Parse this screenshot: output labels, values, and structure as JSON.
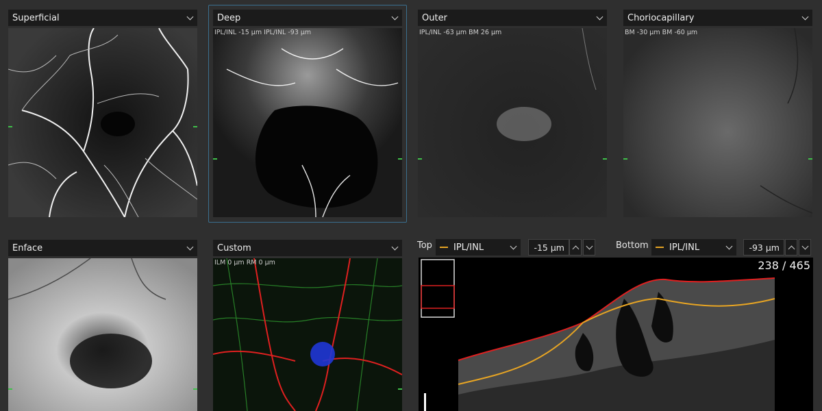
{
  "panels_top": [
    {
      "label": "Superficial",
      "overlay": ""
    },
    {
      "label": "Deep",
      "overlay": "IPL/INL -15 µm  IPL/INL -93 µm"
    },
    {
      "label": "Outer",
      "overlay": "IPL/INL -63 µm   BM 26 µm"
    },
    {
      "label": "Choriocapillary",
      "overlay": "BM -30 µm  BM -60 µm"
    }
  ],
  "panels_bottom": [
    {
      "label": "Enface",
      "overlay": ""
    },
    {
      "label": "Custom",
      "overlay": "ILM 0 µm   RM 0 µm"
    }
  ],
  "bscan_controls": {
    "top_label": "Top",
    "top_layer": "IPL/INL",
    "top_offset": "-15 µm",
    "bottom_label": "Bottom",
    "bottom_layer": "IPL/INL",
    "bottom_offset": "-93 µm",
    "layer_color": "#e8a523"
  },
  "bscan": {
    "counter": "238 / 465",
    "current_slice": 238,
    "total_slices": 465
  },
  "icons": [
    "chevron-down-icon",
    "chevron-up-icon"
  ],
  "colors": {
    "selection_border": "#3a6f8f",
    "boundary_red": "#e02020",
    "boundary_orange": "#e8a523",
    "marker_green": "#3fc04a"
  }
}
